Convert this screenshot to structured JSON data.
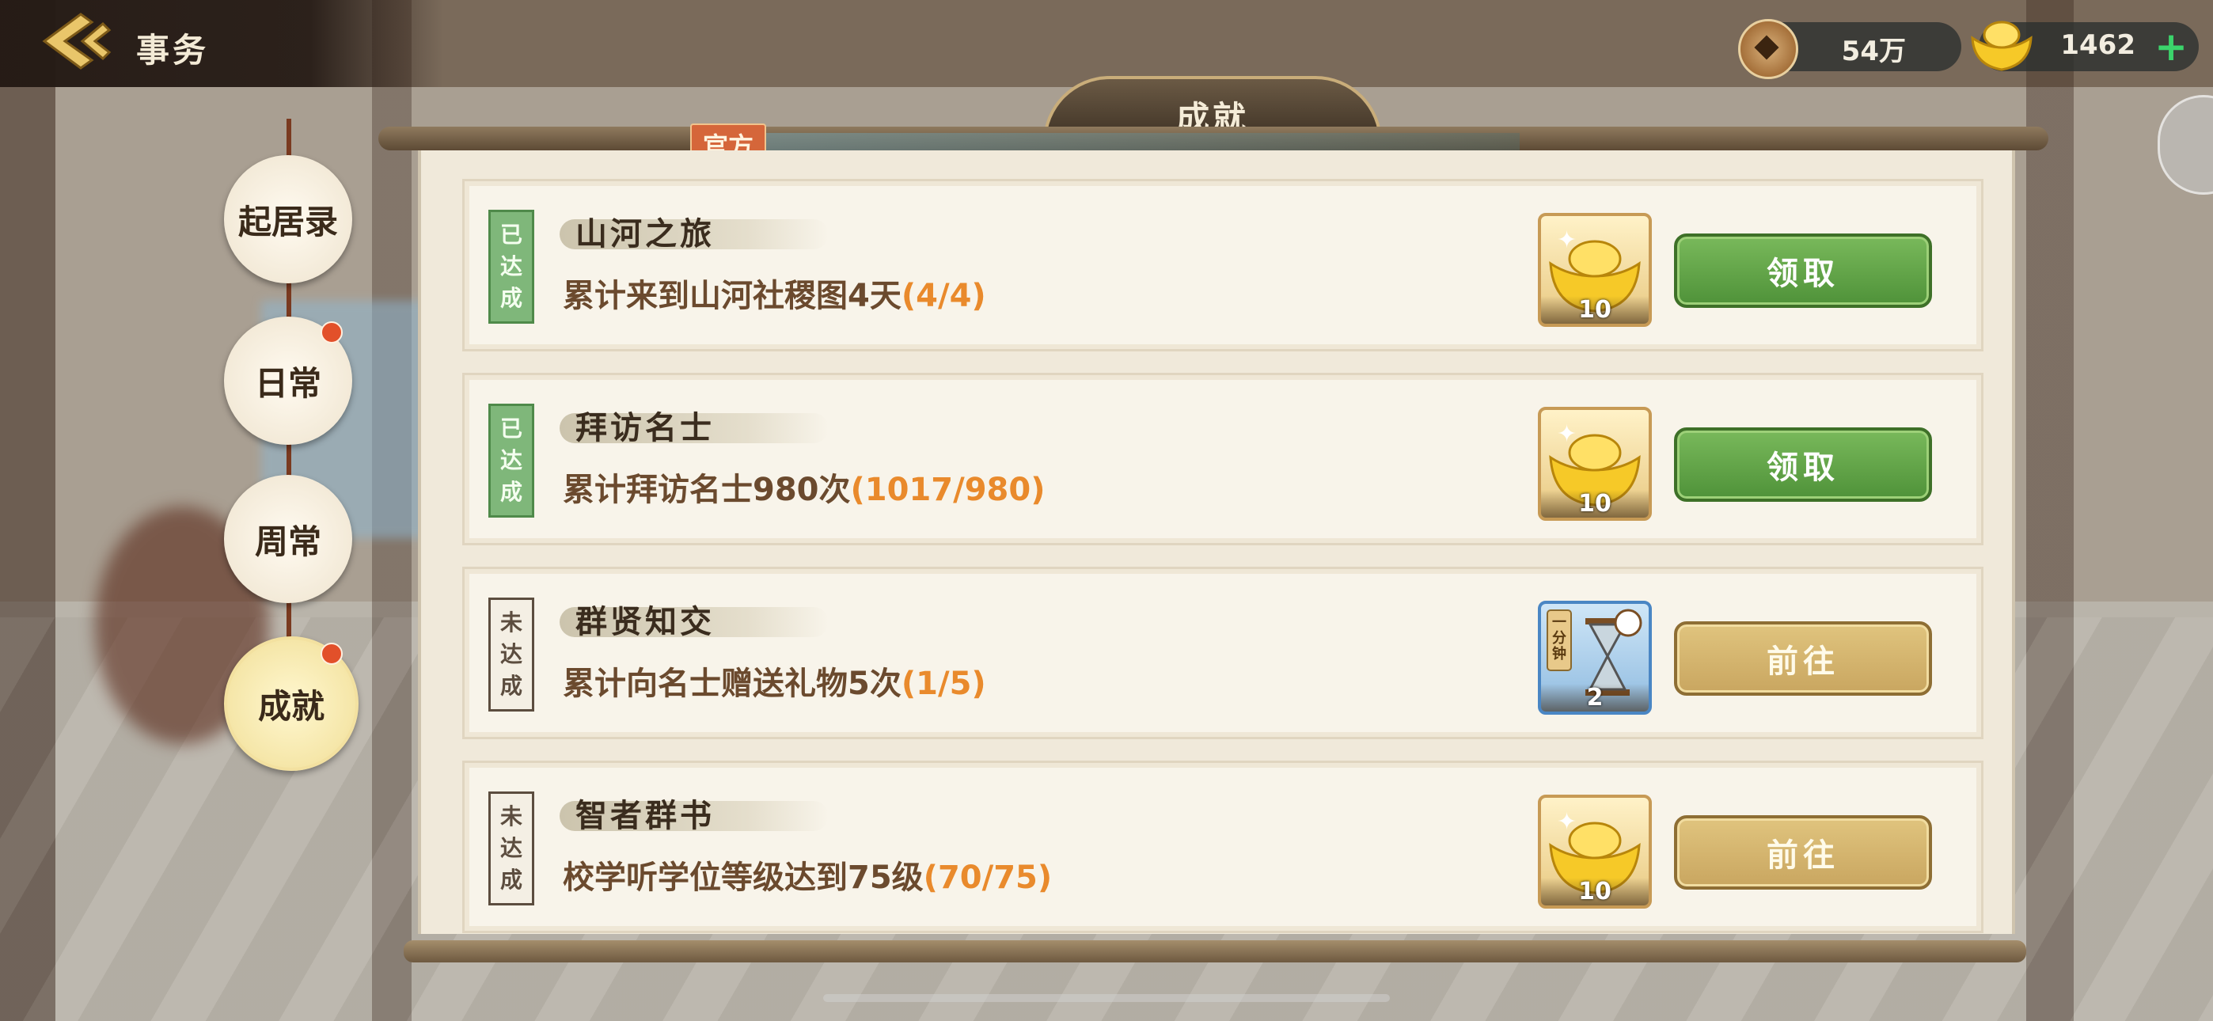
{
  "header": {
    "title": "事务",
    "coins": "54万",
    "gold": "1462"
  },
  "panel": {
    "title": "成就",
    "tag": "官方"
  },
  "nav": [
    {
      "label": "起居录",
      "active": false,
      "dot": false
    },
    {
      "label": "日常",
      "active": false,
      "dot": true
    },
    {
      "label": "周常",
      "active": false,
      "dot": false
    },
    {
      "label": "成就",
      "active": true,
      "dot": true
    }
  ],
  "tasks": [
    {
      "status": [
        "已",
        "达",
        "成"
      ],
      "title": "山河之旅",
      "desc": "累计来到山河社稷图4天",
      "progress": "(4/4)",
      "reward": {
        "icon": "gold-ingot-icon",
        "qty": "10"
      },
      "action": "领取"
    },
    {
      "status": [
        "已",
        "达",
        "成"
      ],
      "title": "拜访名士",
      "desc": "累计拜访名士980次",
      "progress": "(1017/980)",
      "reward": {
        "icon": "gold-ingot-icon",
        "qty": "10"
      },
      "action": "领取"
    },
    {
      "status": [
        "未",
        "达",
        "成"
      ],
      "title": "群贤知交",
      "desc": "累计向名士赠送礼物5次",
      "progress": "(1/5)",
      "reward": {
        "icon": "hourglass-icon",
        "qty": "2",
        "label": "一分钟"
      },
      "action": "前往"
    },
    {
      "status": [
        "未",
        "达",
        "成"
      ],
      "title": "智者群书",
      "desc": "校学听学位等级达到75级",
      "progress": "(70/75)",
      "reward": {
        "icon": "gold-ingot-icon",
        "qty": "10"
      },
      "action": "前往"
    }
  ],
  "colors": {
    "claim_green": "#5a9e43",
    "go_gold": "#d4b46e",
    "progress_orange": "#e98a2c",
    "badge_done": "#7fb77a",
    "nav_dot": "#e2502a"
  }
}
